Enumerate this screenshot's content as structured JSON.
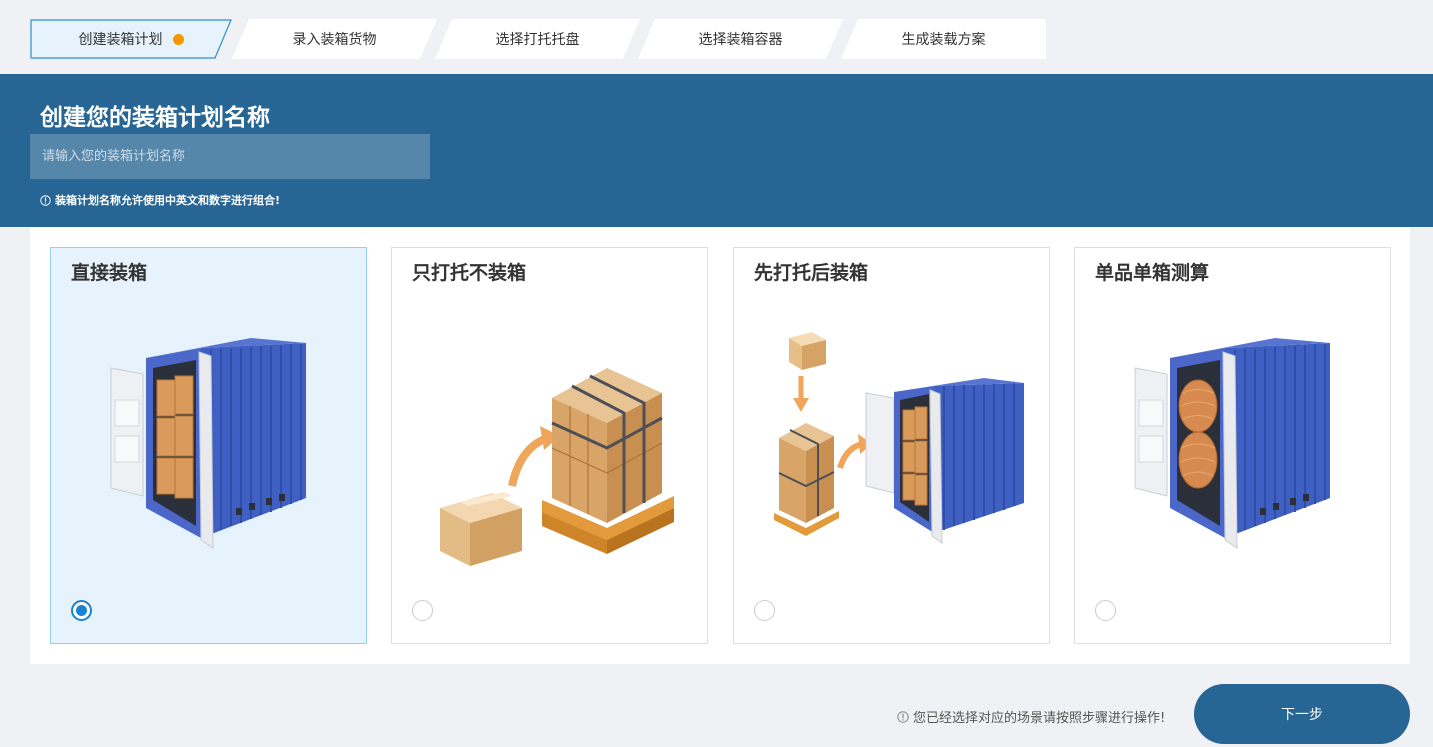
{
  "steps": [
    {
      "label": "创建装箱计划",
      "active": true
    },
    {
      "label": "录入装箱货物"
    },
    {
      "label": "选择打托托盘"
    },
    {
      "label": "选择装箱容器"
    },
    {
      "label": "生成装载方案"
    }
  ],
  "banner": {
    "title": "创建您的装箱计划名称",
    "placeholder": "请输入您的装箱计划名称",
    "hint": "装箱计划名称允许使用中英文和数字进行组合!"
  },
  "cards": [
    {
      "title": "直接装箱",
      "selected": true
    },
    {
      "title": "只打托不装箱",
      "selected": false
    },
    {
      "title": "先打托后装箱",
      "selected": false
    },
    {
      "title": "单品单箱测算",
      "selected": false
    }
  ],
  "footer": {
    "hint": "您已经选择对应的场景请按照步骤进行操作!",
    "next_label": "下一步"
  },
  "colors": {
    "primary": "#276694",
    "accent_dot": "#f39800",
    "radio_selected": "#1a82d0",
    "card_selected_bg": "#e6f3fd"
  }
}
